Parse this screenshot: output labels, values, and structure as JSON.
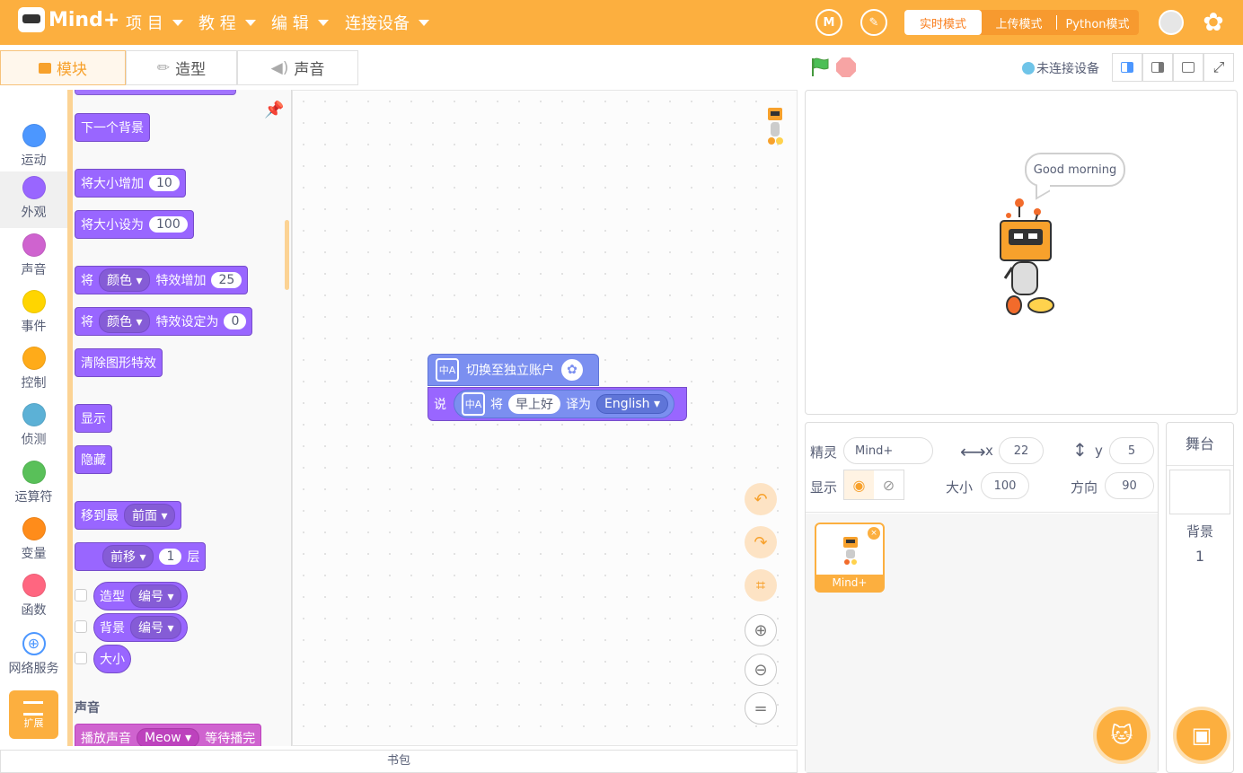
{
  "header": {
    "logo_text": "Mind+",
    "menus": [
      "项 目",
      "教 程",
      "编 辑",
      "连接设备"
    ],
    "modes": [
      "实时模式",
      "上传模式",
      "Python模式"
    ],
    "active_mode_index": 0
  },
  "tabs": [
    "模块",
    "造型",
    "声音"
  ],
  "categories": [
    {
      "label": "运动",
      "color": "#4c97ff"
    },
    {
      "label": "外观",
      "color": "#9966ff"
    },
    {
      "label": "声音",
      "color": "#cf63cf"
    },
    {
      "label": "事件",
      "color": "#ffd500"
    },
    {
      "label": "控制",
      "color": "#ffab19"
    },
    {
      "label": "侦测",
      "color": "#5cb1d6"
    },
    {
      "label": "运算符",
      "color": "#59c059"
    },
    {
      "label": "变量",
      "color": "#ff8c1a"
    },
    {
      "label": "函数",
      "color": "#ff6680"
    },
    {
      "label": "网络服务",
      "color": "#4c97ff"
    }
  ],
  "extension_label": "扩展",
  "palette": {
    "next_backdrop": "下一个背景",
    "change_size": {
      "text": "将大小增加",
      "value": "10"
    },
    "set_size": {
      "text": "将大小设为",
      "value": "100"
    },
    "change_effect": {
      "pre": "将",
      "effect": "颜色",
      "text": "特效增加",
      "value": "25"
    },
    "set_effect": {
      "pre": "将",
      "effect": "颜色",
      "text": "特效设定为",
      "value": "0"
    },
    "clear_effects": "清除图形特效",
    "show": "显示",
    "hide": "隐藏",
    "go_to": {
      "text": "移到最",
      "option": "前面"
    },
    "go_layers": {
      "option": "前移",
      "value": "1",
      "suffix": "层"
    },
    "costume_rep": {
      "text": "造型",
      "option": "编号"
    },
    "backdrop_rep": {
      "text": "背景",
      "option": "编号"
    },
    "size_rep": "大小",
    "section_sound": "声音",
    "play_sound": {
      "text": "播放声音",
      "option": "Meow",
      "suffix": "等待播完"
    }
  },
  "script": {
    "block1": "切换至独立账户",
    "say": "说",
    "translate_pre": "将",
    "translate_text": "早上好",
    "translate_mid": "译为",
    "translate_lang": "English"
  },
  "backpack": "书包",
  "stage": {
    "connection": "未连接设备",
    "speech": "Good morning"
  },
  "sprite": {
    "label_sprite": "精灵",
    "name": "Mind+",
    "x_label": "x",
    "x": "22",
    "y_label": "y",
    "y": "5",
    "show_label": "显示",
    "size_label": "大小",
    "size": "100",
    "direction_label": "方向",
    "direction": "90",
    "thumb_name": "Mind+"
  },
  "stage_panel": {
    "title": "舞台",
    "backdrop_label": "背景",
    "backdrop_count": "1"
  }
}
